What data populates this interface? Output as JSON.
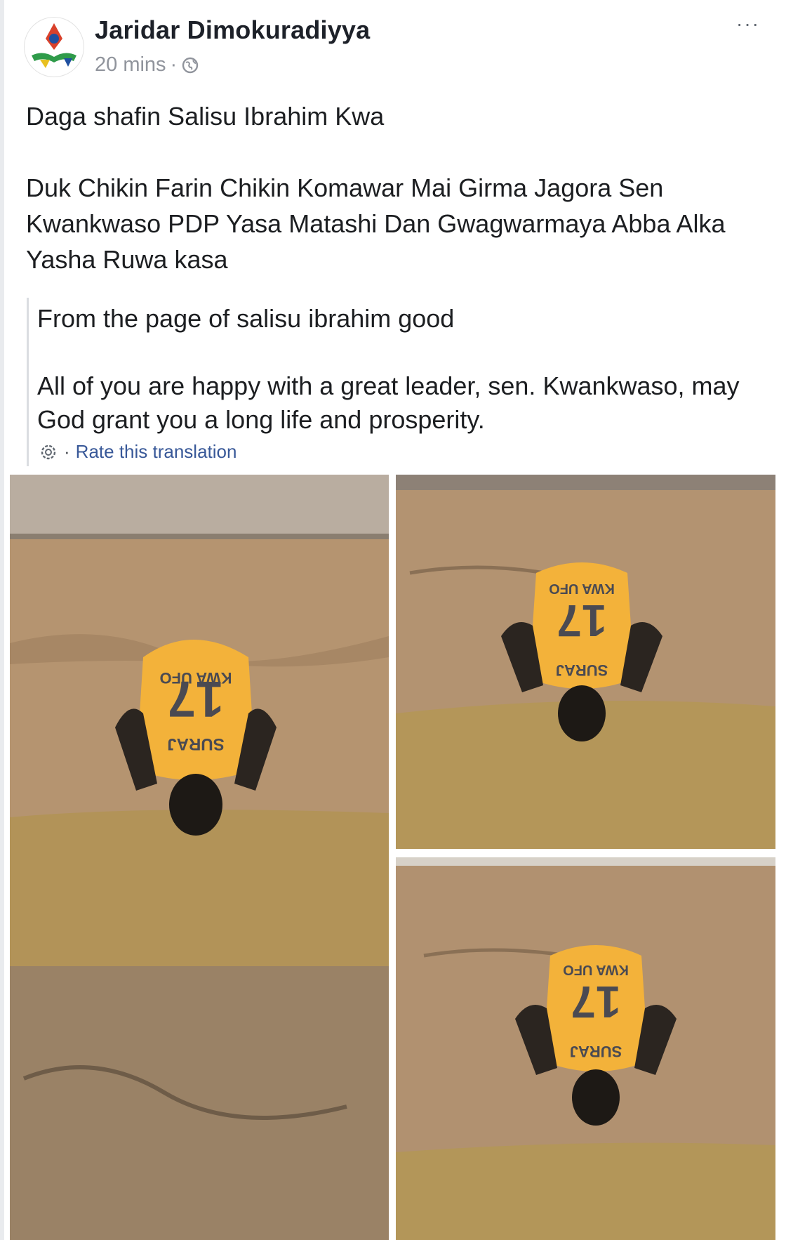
{
  "post": {
    "author": "Jaridar Dimokuradiyya",
    "time": "20 mins",
    "separator": "·",
    "privacy_icon": "globe-icon",
    "more_label": "···",
    "original_line1": "Daga shafin Salisu Ibrahim Kwa",
    "original_line2": "Duk Chikin Farin Chikin Komawar Mai Girma Jagora Sen Kwankwaso PDP Yasa Matashi Dan Gwagwarmaya Abba Alka Yasha Ruwa kasa",
    "translation_line1": "From the page of salisu ibrahim good",
    "translation_line2": "All of you are happy with a great leader, sen. Kwankwaso, may God grant you a long life and prosperity.",
    "rate_separator": "·",
    "rate_link": "Rate this translation"
  },
  "photos": {
    "jersey_number": "17",
    "jersey_name": "SURAJ",
    "jersey_top": "KWA UFO"
  },
  "colors": {
    "link": "#385898",
    "meta": "#90949c",
    "jersey": "#f3b23a",
    "mud": "#b3926b",
    "water": "#b09156"
  }
}
